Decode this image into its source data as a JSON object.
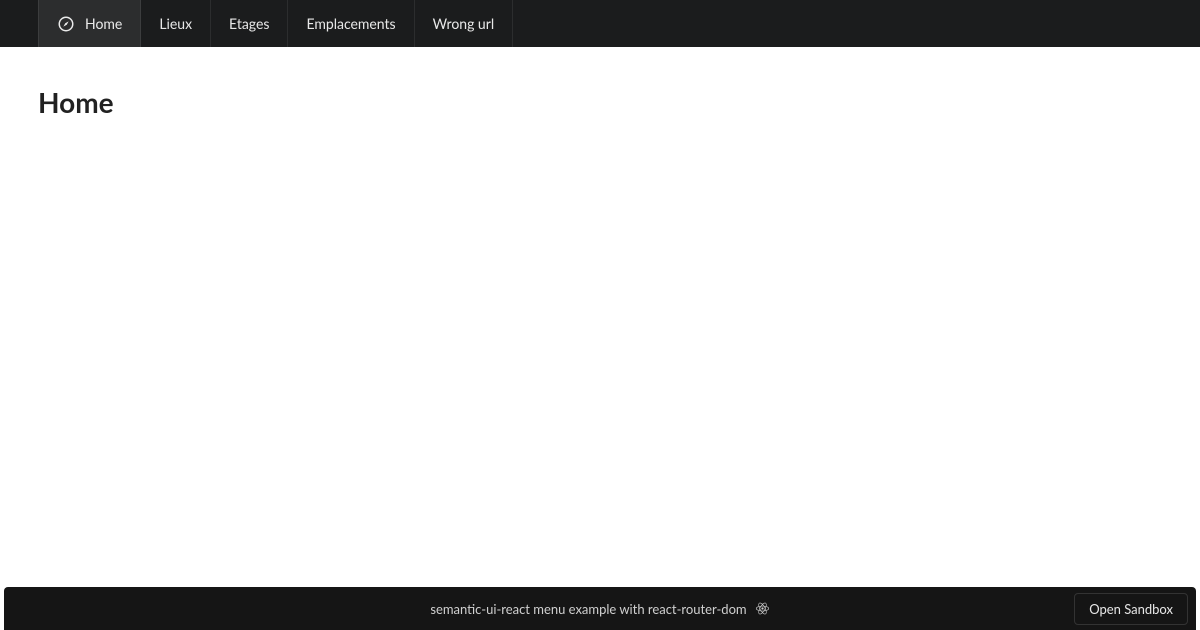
{
  "nav": {
    "items": [
      {
        "label": "Home",
        "active": true,
        "hasIcon": true
      },
      {
        "label": "Lieux",
        "active": false
      },
      {
        "label": "Etages",
        "active": false
      },
      {
        "label": "Emplacements",
        "active": false
      },
      {
        "label": "Wrong url",
        "active": false
      }
    ]
  },
  "page": {
    "title": "Home"
  },
  "footer": {
    "description": "semantic-ui-react menu example with react-router-dom",
    "button": "Open Sandbox"
  }
}
